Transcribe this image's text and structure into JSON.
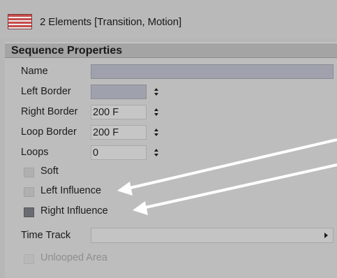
{
  "header": {
    "title": "2 Elements [Transition, Motion]"
  },
  "section": {
    "title": "Sequence Properties"
  },
  "fields": {
    "name_label": "Name",
    "name_value": "",
    "left_border_label": "Left Border",
    "left_border_value": "",
    "right_border_label": "Right Border",
    "right_border_value": "200 F",
    "loop_border_label": "Loop Border",
    "loop_border_value": "200 F",
    "loops_label": "Loops",
    "loops_value": "0"
  },
  "checkboxes": {
    "soft": "Soft",
    "left_influence": "Left Influence",
    "right_influence": "Right Influence",
    "unlooped_area": "Unlooped Area"
  },
  "states": {
    "soft_checked": false,
    "left_influence_checked": false,
    "right_influence_checked": true,
    "unlooped_area_enabled": false
  },
  "time_track": {
    "label": "Time Track",
    "value": ""
  },
  "colors": {
    "panel_bg": "#bdbdbd",
    "field_bg": "#9fa2ad",
    "header_bg": "#a4a4a4",
    "arrow": "#ffffff"
  }
}
